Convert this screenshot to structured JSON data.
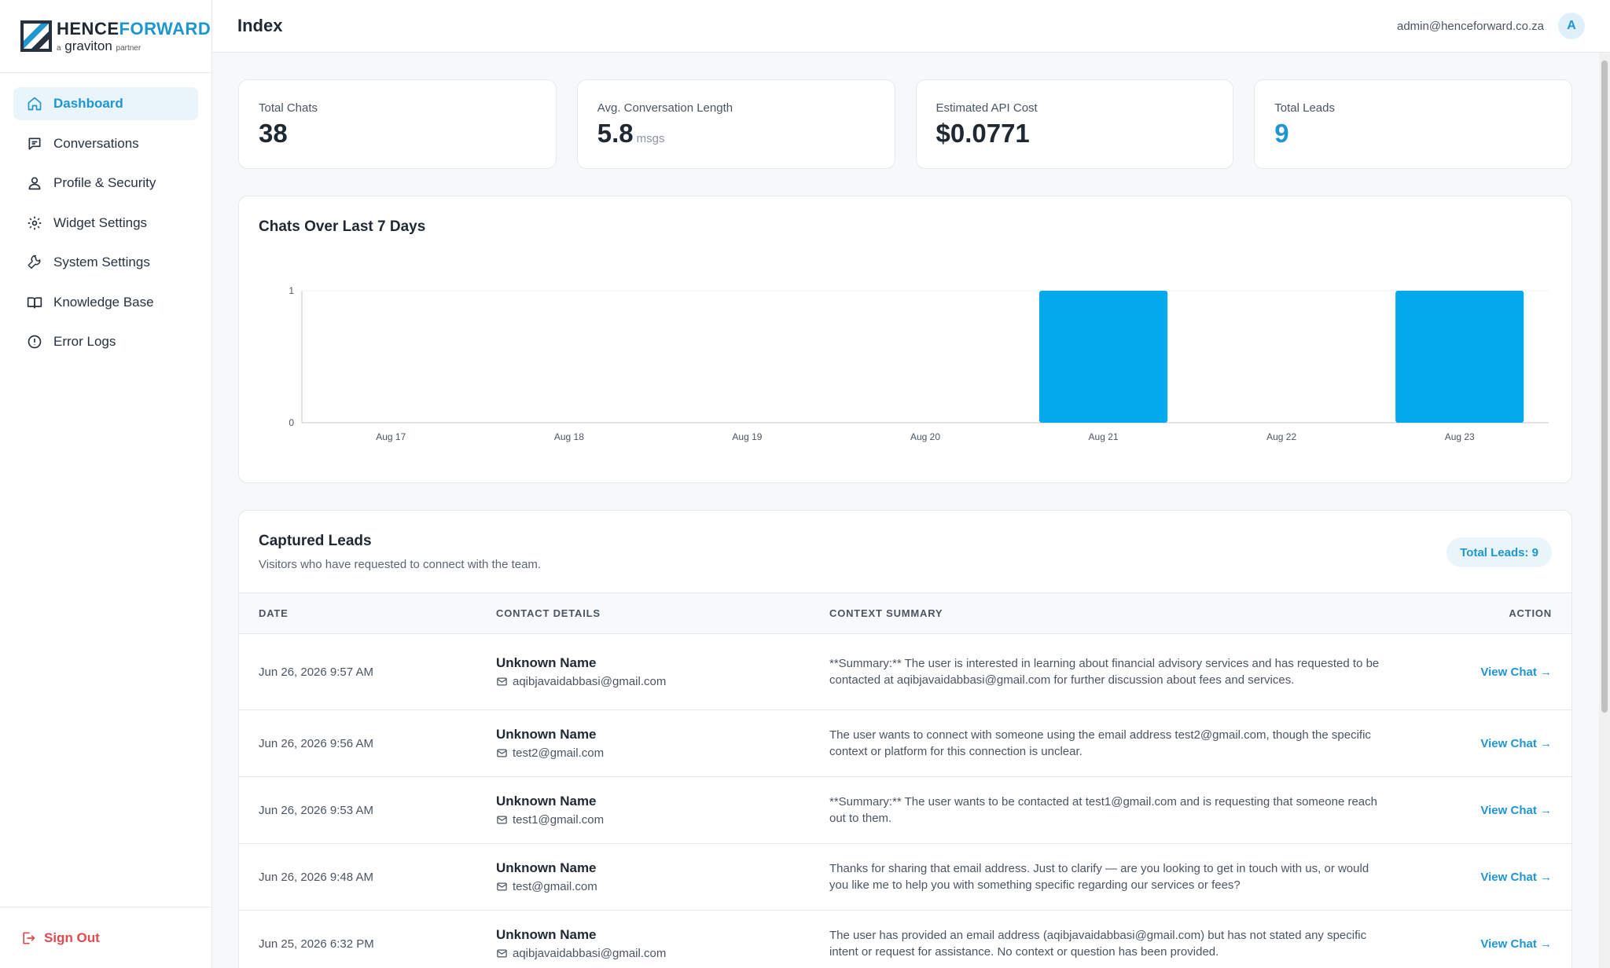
{
  "brand": {
    "name_part1": "HENCE",
    "name_part2": "FORWARD",
    "tag_a": "a",
    "tag_name": "graviton",
    "tag_partner": "partner"
  },
  "sidebar": {
    "items": [
      {
        "label": "Dashboard",
        "icon": "home-icon"
      },
      {
        "label": "Conversations",
        "icon": "chat-bubble-icon"
      },
      {
        "label": "Profile & Security",
        "icon": "user-icon"
      },
      {
        "label": "Widget Settings",
        "icon": "gear-icon"
      },
      {
        "label": "System Settings",
        "icon": "wrench-icon"
      },
      {
        "label": "Knowledge Base",
        "icon": "book-icon"
      },
      {
        "label": "Error Logs",
        "icon": "alert-circle-icon"
      }
    ],
    "sign_out": "Sign Out"
  },
  "header": {
    "title": "Index",
    "email": "admin@henceforward.co.za",
    "avatar_initial": "A"
  },
  "stats": [
    {
      "label": "Total Chats",
      "value": "38",
      "unit": ""
    },
    {
      "label": "Avg. Conversation Length",
      "value": "5.8",
      "unit": "msgs"
    },
    {
      "label": "Estimated API Cost",
      "value": "$0.0771",
      "unit": ""
    },
    {
      "label": "Total Leads",
      "value": "9",
      "unit": ""
    }
  ],
  "chart_data": {
    "type": "bar",
    "title": "Chats Over Last 7 Days",
    "categories": [
      "Aug 17",
      "Aug 18",
      "Aug 19",
      "Aug 20",
      "Aug 21",
      "Aug 22",
      "Aug 23"
    ],
    "values": [
      0,
      0,
      0,
      0,
      1,
      0,
      1
    ],
    "ylim": [
      0,
      1
    ],
    "yticks": [
      "0",
      "1"
    ],
    "bar_color": "#03a9ec",
    "grid": false
  },
  "leads": {
    "title": "Captured Leads",
    "subtitle": "Visitors who have requested to connect with the team.",
    "badge": "Total Leads: 9",
    "columns": {
      "date": "DATE",
      "contact": "CONTACT DETAILS",
      "summary": "CONTEXT SUMMARY",
      "action": "ACTION"
    },
    "action_label": "View Chat →",
    "rows": [
      {
        "date": "Jun 26, 2026 9:57 AM",
        "name": "Unknown Name",
        "email": "aqibjavaidabbasi@gmail.com",
        "summary": "**Summary:** The user is interested in learning about financial advisory services and has requested to be contacted at aqibjavaidabbasi@gmail.com for further discussion about fees and services."
      },
      {
        "date": "Jun 26, 2026 9:56 AM",
        "name": "Unknown Name",
        "email": "test2@gmail.com",
        "summary": "The user wants to connect with someone using the email address test2@gmail.com, though the specific context or platform for this connection is unclear."
      },
      {
        "date": "Jun 26, 2026 9:53 AM",
        "name": "Unknown Name",
        "email": "test1@gmail.com",
        "summary": "**Summary:** The user wants to be contacted at test1@gmail.com and is requesting that someone reach out to them."
      },
      {
        "date": "Jun 26, 2026 9:48 AM",
        "name": "Unknown Name",
        "email": "test@gmail.com",
        "summary": "Thanks for sharing that email address. Just to clarify — are you looking to get in touch with us, or would you like me to help you with something specific regarding our services or fees?"
      },
      {
        "date": "Jun 25, 2026 6:32 PM",
        "name": "Unknown Name",
        "email": "aqibjavaidabbasi@gmail.com",
        "summary": "The user has provided an email address (aqibjavaidabbasi@gmail.com) but has not stated any specific intent or request for assistance. No context or question has been provided."
      }
    ]
  }
}
